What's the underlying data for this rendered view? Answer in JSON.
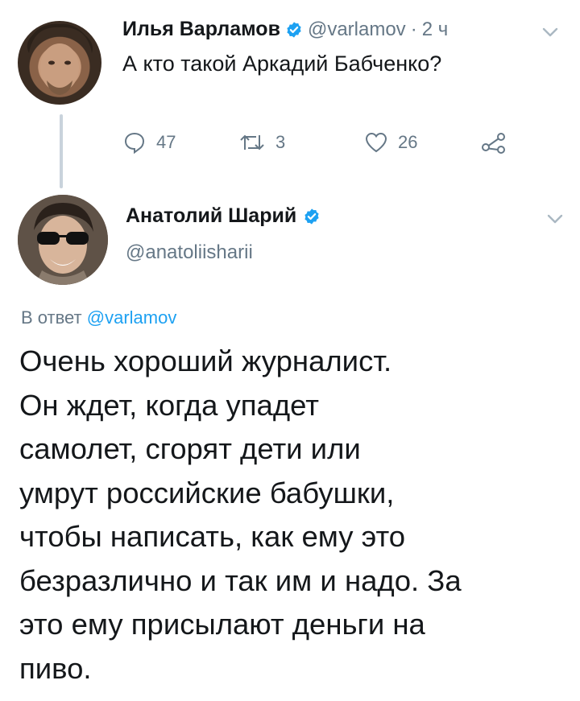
{
  "tweet1": {
    "author_name": "Илья Варламов",
    "handle": "@varlamov",
    "separator": "·",
    "time": "2 ч",
    "text": "А кто такой Аркадий Бабченко?",
    "replies": "47",
    "retweets": "3",
    "likes": "26"
  },
  "tweet2": {
    "author_name": "Анатолий Шарий",
    "handle": "@anatoliisharii",
    "reply_prefix": "В ответ ",
    "reply_handle": "@varlamov",
    "text_lines": [
      "Очень хороший журналист.",
      "Он ждет, когда упадет",
      "самолет, сгорят дети или",
      "умрут российские бабушки,",
      "чтобы написать, как ему это",
      "безразлично и так им и надо. За",
      "это ему присылают деньги на",
      "пиво."
    ]
  },
  "colors": {
    "accent": "#1da1f2",
    "secondary_text": "#657786",
    "thread_line": "#c9d3dc"
  },
  "icons": [
    "reply-icon",
    "retweet-icon",
    "like-icon",
    "share-icon",
    "verified-badge-icon",
    "chevron-down-icon"
  ]
}
